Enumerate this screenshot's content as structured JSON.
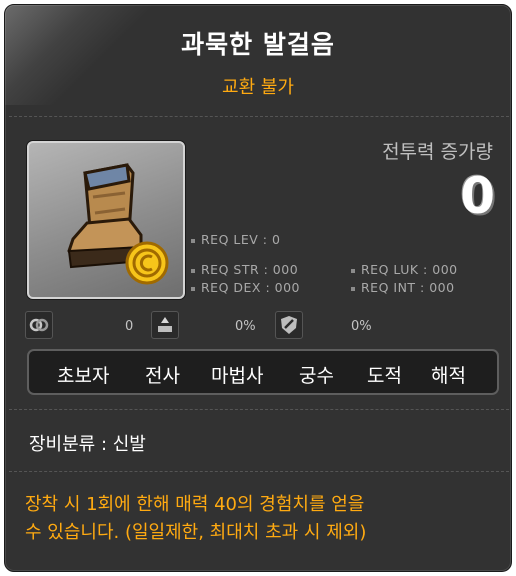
{
  "item": {
    "name": "과묵한 발걸음",
    "trade_status": "교환 불가",
    "power_label": "전투력 증가량",
    "power_value": "0"
  },
  "requirements": {
    "lev": "REQ LEV :   0",
    "str": "REQ STR : 000",
    "luk": "REQ LUK : 000",
    "dex": "REQ DEX : 000",
    "int": "REQ INT : 000"
  },
  "stats": {
    "first_value": "0",
    "second_value": "0%",
    "third_value": "0%"
  },
  "jobs": [
    "초보자",
    "전사",
    "마법사",
    "궁수",
    "도적",
    "해적"
  ],
  "category": "장비분류 : 신발",
  "description": {
    "line1": "장착 시 1회에 한해 매력 40의 경험치를 얻을",
    "line2": "수 있습니다. (일일제한, 최대치 초과 시 제외)"
  },
  "icons": {
    "item": "boot-icon",
    "coin": "coin-icon",
    "stat1": "chain-icon",
    "stat2": "star-up-icon",
    "stat3": "shield-icon"
  },
  "colors": {
    "background": "#323232",
    "title": "#ffffff",
    "accent": "#ffaa11",
    "muted": "#a9a9a9"
  }
}
